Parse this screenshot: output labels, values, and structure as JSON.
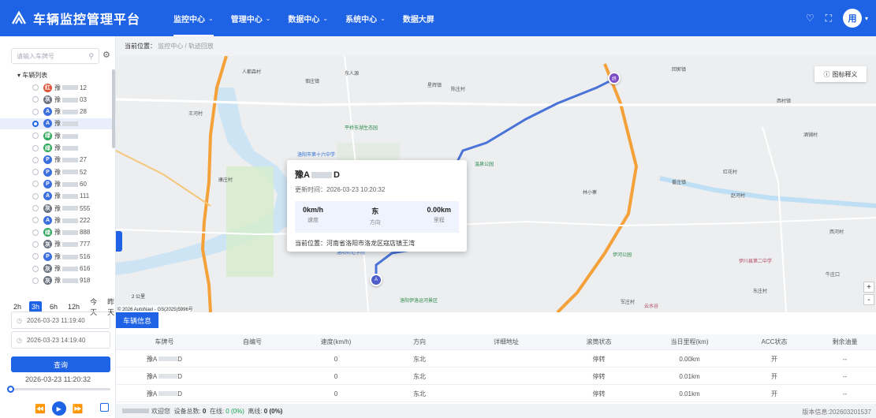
{
  "header": {
    "title": "车辆监控管理平台",
    "nav": [
      {
        "label": "监控中心",
        "chevron": "⌄",
        "active": true
      },
      {
        "label": "管理中心",
        "chevron": "⌄"
      },
      {
        "label": "数据中心",
        "chevron": "⌄"
      },
      {
        "label": "系统中心",
        "chevron": "⌄"
      },
      {
        "label": "数据大屏",
        "chevron": ""
      }
    ],
    "avatar": "用"
  },
  "sidebar": {
    "search_placeholder": "请输入车牌号",
    "tree_root": "车辆列表",
    "vehicles": [
      {
        "icon": "红",
        "color": "#e0533b",
        "suffix": "12",
        "prefix": "豫"
      },
      {
        "icon": "灰",
        "color": "#6b7280",
        "suffix": "03",
        "prefix": "豫"
      },
      {
        "icon": "A",
        "color": "#3b6fe0",
        "suffix": "28",
        "prefix": "豫"
      },
      {
        "icon": "A",
        "color": "#3b6fe0",
        "suffix": "",
        "prefix": "豫",
        "selected": true
      },
      {
        "icon": "绿",
        "color": "#2ea65a",
        "suffix": "",
        "prefix": "豫"
      },
      {
        "icon": "绿",
        "color": "#2ea65a",
        "suffix": "",
        "prefix": "豫"
      },
      {
        "icon": "P",
        "color": "#3b6fe0",
        "suffix": "27",
        "prefix": "豫"
      },
      {
        "icon": "P",
        "color": "#3b6fe0",
        "suffix": "52",
        "prefix": "豫"
      },
      {
        "icon": "P",
        "color": "#3b6fe0",
        "suffix": "60",
        "prefix": "豫"
      },
      {
        "icon": "A",
        "color": "#3b6fe0",
        "suffix": "111",
        "prefix": "豫"
      },
      {
        "icon": "灰",
        "color": "#6b7280",
        "suffix": "555",
        "prefix": "豫"
      },
      {
        "icon": "A",
        "color": "#3b6fe0",
        "suffix": "222",
        "prefix": "豫"
      },
      {
        "icon": "绿",
        "color": "#2ea65a",
        "suffix": "888",
        "prefix": "豫"
      },
      {
        "icon": "灰",
        "color": "#6b7280",
        "suffix": "777",
        "prefix": "豫"
      },
      {
        "icon": "P",
        "color": "#3b6fe0",
        "suffix": "516",
        "prefix": "豫"
      },
      {
        "icon": "灰",
        "color": "#6b7280",
        "suffix": "616",
        "prefix": "豫"
      },
      {
        "icon": "灰",
        "color": "#6b7280",
        "suffix": "918",
        "prefix": "豫"
      }
    ],
    "time_tabs": [
      {
        "label": "2h"
      },
      {
        "label": "3h",
        "active": true
      },
      {
        "label": "6h"
      },
      {
        "label": "12h"
      },
      {
        "label": "今天"
      },
      {
        "label": "昨天"
      }
    ],
    "start_time": "2026-03-23 11:19:40",
    "end_time": "2026-03-23 14:19:40",
    "query_label": "查询",
    "current_time": "2026-03-23 11:20:32",
    "playback_progress": 0.0
  },
  "breadcrumb": {
    "label": "当前位置：",
    "parent": "监控中心",
    "sep": "/",
    "current": "轨迹回放"
  },
  "map": {
    "legend_label": "图标释义",
    "scale_label": "2 公里",
    "copyright": "© 2026 AutoNavi - GS(2025)5996号",
    "zoom_in": "+",
    "zoom_out": "-",
    "labels": [
      {
        "text": "人都森村",
        "type": "lbl"
      },
      {
        "text": "东人源",
        "type": "lbl"
      },
      {
        "text": "佃庄镇",
        "type": "lbl"
      },
      {
        "text": "星辉镇",
        "type": "lbl"
      },
      {
        "text": "陈庄村",
        "type": "lbl"
      },
      {
        "text": "回郭镇",
        "type": "lbl"
      },
      {
        "text": "王河村",
        "type": "lbl"
      },
      {
        "text": "酒铺村",
        "type": "lbl"
      },
      {
        "text": "西村镇",
        "type": "lbl"
      },
      {
        "text": "康庄村",
        "type": "lbl"
      },
      {
        "text": "番庄镇",
        "type": "lbl"
      },
      {
        "text": "红花村",
        "type": "lbl"
      },
      {
        "text": "林小寨",
        "type": "lbl"
      },
      {
        "text": "赵河村",
        "type": "lbl"
      },
      {
        "text": "西河村",
        "type": "lbl"
      },
      {
        "text": "牛庄口",
        "type": "lbl"
      },
      {
        "text": "东庄村",
        "type": "lbl"
      },
      {
        "text": "军庄村",
        "type": "lbl"
      }
    ],
    "pois": [
      {
        "text": "洛阳市第十六中学",
        "type": "poi-b"
      },
      {
        "text": "平桥东湖生态园",
        "type": "poi"
      },
      {
        "text": "温泉公园",
        "type": "poi"
      },
      {
        "text": "洛阳师范学院",
        "type": "poi-b"
      },
      {
        "text": "伊河公园",
        "type": "poi"
      },
      {
        "text": "伊川县第二中学",
        "type": "poi-r"
      },
      {
        "text": "洛阳伊洛运河景区",
        "type": "poi"
      },
      {
        "text": "云水谷",
        "type": "poi-r"
      }
    ],
    "popup": {
      "plate_prefix": "豫A",
      "plate_suffix": "D",
      "updated": "更新时间：2026-03-23 10:20:32",
      "speed_value": "0km/h",
      "speed_label": "速度",
      "direction_value": "东",
      "direction_label": "方向",
      "mileage_value": "0.00km",
      "mileage_label": "里程",
      "location": "当前位置：河南省洛阳市洛龙区寇店镇王湾"
    },
    "end_marker": "终",
    "start_marker": "A"
  },
  "table": {
    "tab_label": "车辆信息",
    "columns": [
      "车牌号",
      "自编号",
      "速度(km/h)",
      "方向",
      "详细地址",
      "滚筒状态",
      "当日里程(km)",
      "ACC状态",
      "剩余油量"
    ],
    "rows": [
      {
        "plate": "豫A",
        "plate_end": "D",
        "self_no": "",
        "speed": "0",
        "direction": "东北",
        "address": "",
        "drum": "停转",
        "mileage": "0.00km",
        "acc": "开",
        "fuel": "--"
      },
      {
        "plate": "豫A",
        "plate_end": "D",
        "self_no": "",
        "speed": "0",
        "direction": "东北",
        "address": "",
        "drum": "停转",
        "mileage": "0.01km",
        "acc": "开",
        "fuel": "--"
      },
      {
        "plate": "豫A",
        "plate_end": "D",
        "self_no": "",
        "speed": "0",
        "direction": "东北",
        "address": "",
        "drum": "停转",
        "mileage": "0.01km",
        "acc": "开",
        "fuel": "--"
      }
    ]
  },
  "footer": {
    "welcome": "欢迎您",
    "total_label": "设备总数:",
    "total": "0",
    "online_label": "在线:",
    "online": "0 (0%)",
    "offline_label": "离线:",
    "offline": "0 (0%)",
    "version": "版本信息:202603201537"
  },
  "colors": {
    "primary": "#1e62e6",
    "route": "#4a73d8",
    "highway": "#f4a13a",
    "green": "#13a14a"
  }
}
